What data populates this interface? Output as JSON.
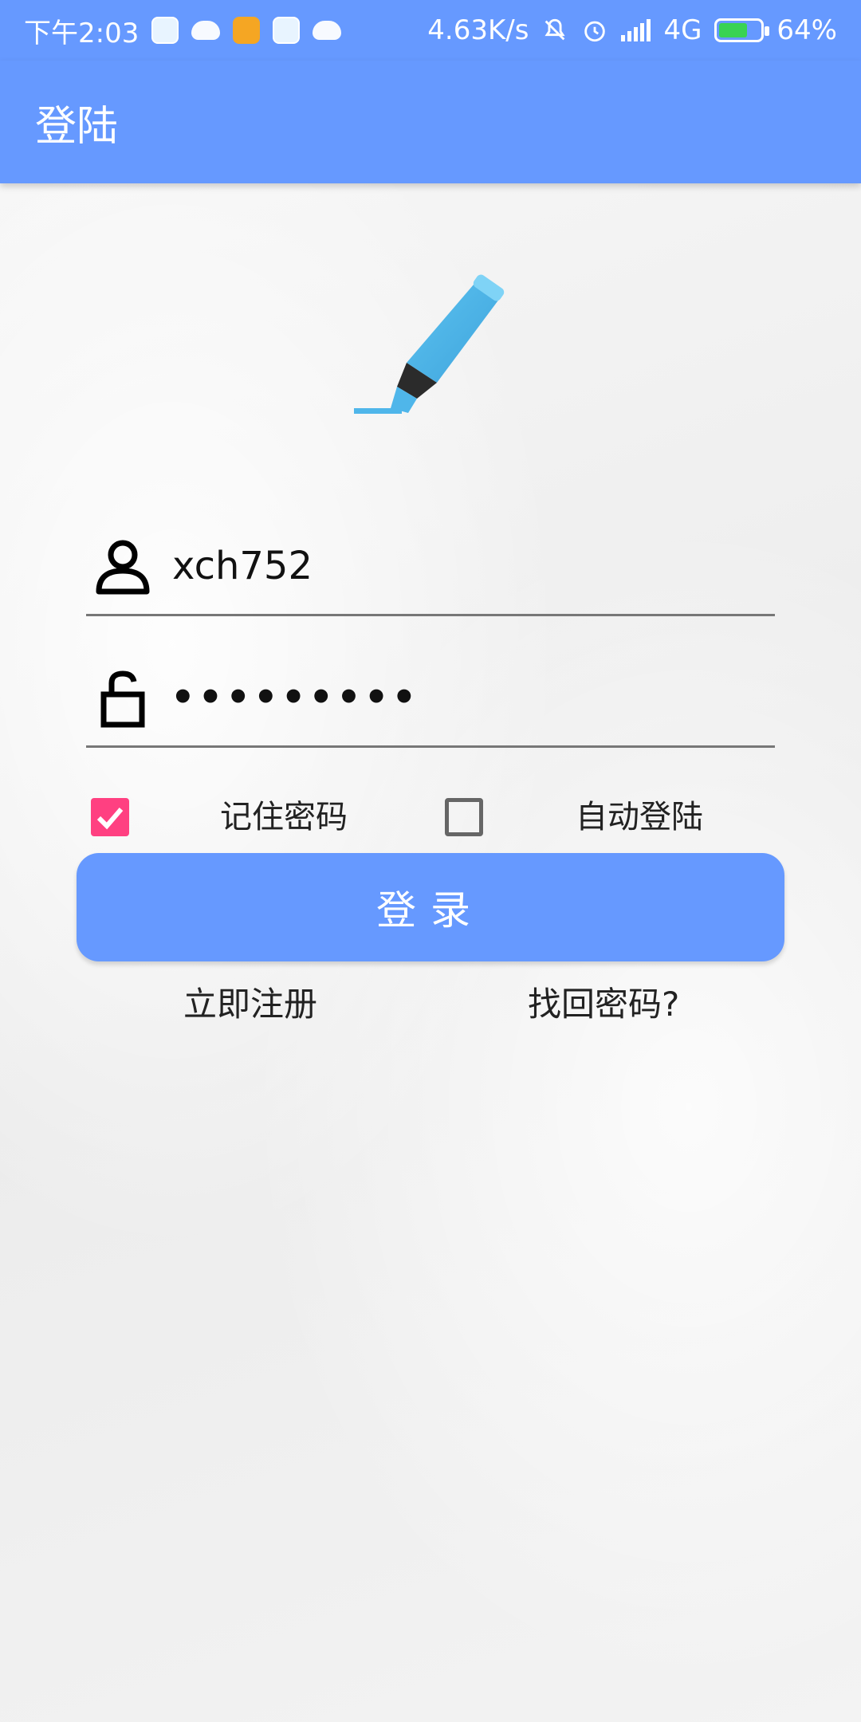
{
  "status_bar": {
    "time": "下午2:03",
    "net_speed": "4.63K/s",
    "network": "4G",
    "battery": "64%"
  },
  "app_bar": {
    "title": "登陆"
  },
  "login_form": {
    "username_value": "xch752",
    "password_masked": "•••••••••",
    "remember_password_label": "记住密码",
    "remember_password_checked": true,
    "auto_login_label": "自动登陆",
    "auto_login_checked": false,
    "login_button_label": "登录",
    "register_link": "立即注册",
    "forgot_password_link": "找回密码?"
  },
  "icons": {
    "logo": "highlighter-pen-icon",
    "username": "user-icon",
    "password": "unlock-icon",
    "remember_check": "checkbox-checked-icon",
    "auto_check": "checkbox-empty-icon"
  },
  "colors": {
    "primary": "#6699ff",
    "accent": "#ff4081",
    "logo_blue": "#4fb6ea"
  }
}
